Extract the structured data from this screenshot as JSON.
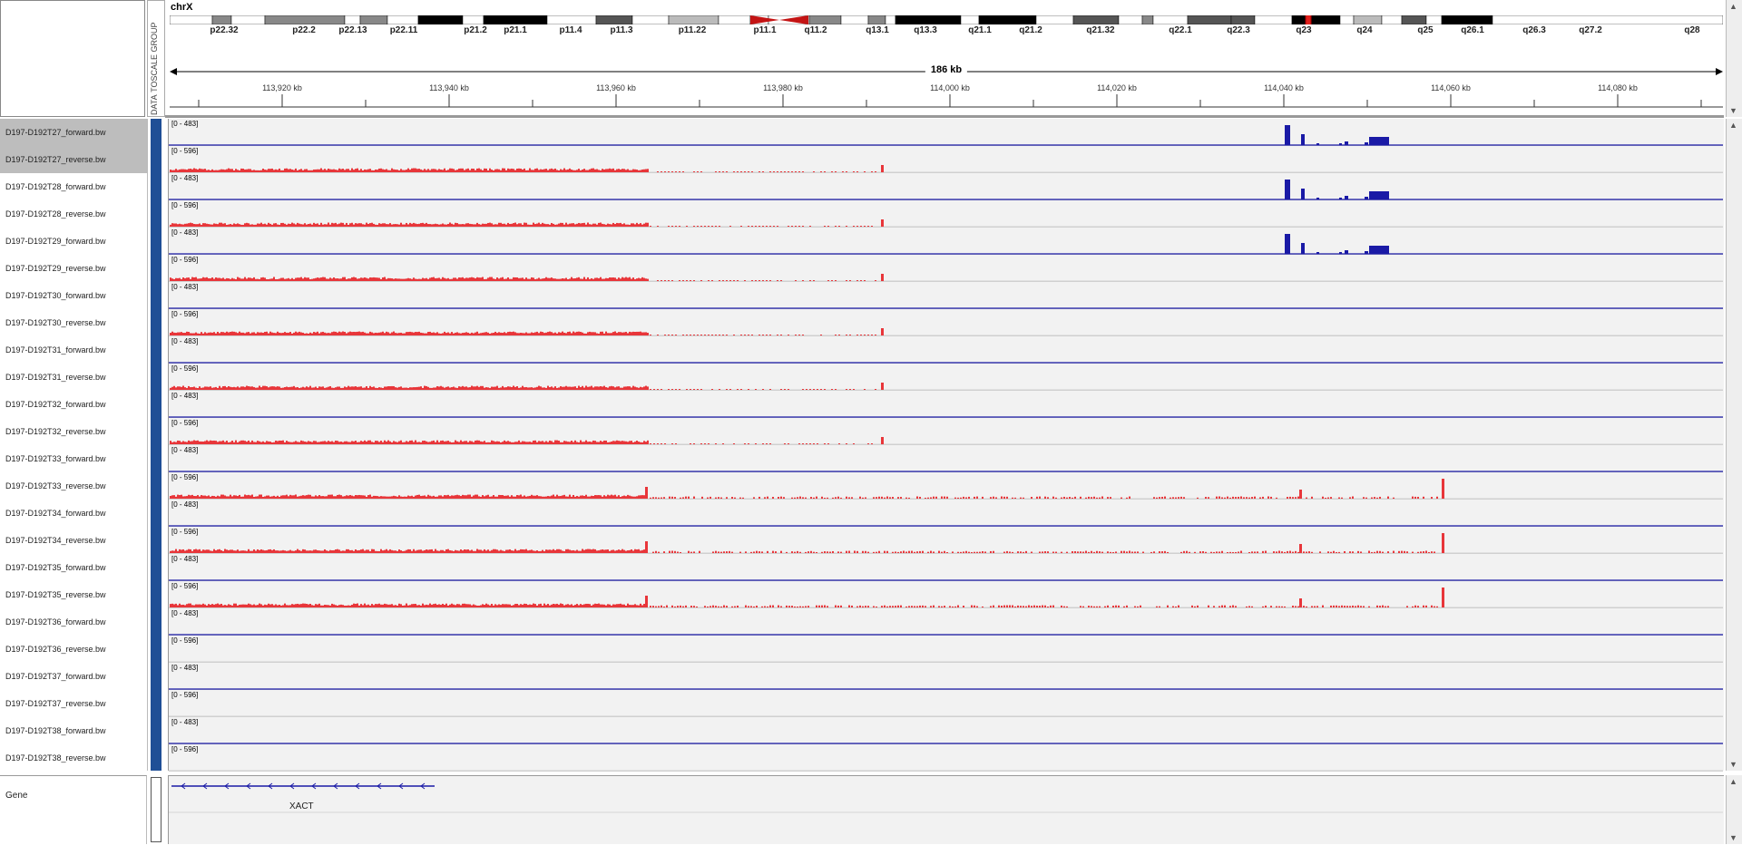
{
  "header": {
    "chromosome": "chrX",
    "span_label": "186 kb",
    "attribute_label": "DATA TOSCALE GROUP",
    "bands": [
      {
        "label": "p22.32"
      },
      {
        "label": "p22.2"
      },
      {
        "label": "p22.13"
      },
      {
        "label": "p22.11"
      },
      {
        "label": "p21.2"
      },
      {
        "label": "p21.1"
      },
      {
        "label": "p11.4"
      },
      {
        "label": "p11.3"
      },
      {
        "label": "p11.22"
      },
      {
        "label": "p11.1"
      },
      {
        "label": "q11.2"
      },
      {
        "label": "q13.1"
      },
      {
        "label": "q13.3"
      },
      {
        "label": "q21.1"
      },
      {
        "label": "q21.2"
      },
      {
        "label": "q21.32"
      },
      {
        "label": "q22.1"
      },
      {
        "label": "q22.3"
      },
      {
        "label": "q23"
      },
      {
        "label": "q24"
      },
      {
        "label": "q25"
      },
      {
        "label": "q26.1"
      },
      {
        "label": "q26.3"
      },
      {
        "label": "q27.2"
      },
      {
        "label": "q28"
      }
    ],
    "ticks": [
      "113,920 kb",
      "113,940 kb",
      "113,960 kb",
      "113,980 kb",
      "114,000 kb",
      "114,020 kb",
      "114,040 kb",
      "114,060 kb",
      "114,080 kb"
    ]
  },
  "tracks": [
    {
      "name": "D197-D192T27_forward.bw",
      "scale": "[0 - 483]",
      "strand": "forward",
      "selected": true,
      "signal": "fwd_peaks"
    },
    {
      "name": "D197-D192T27_reverse.bw",
      "scale": "[0 - 596]",
      "strand": "reverse",
      "selected": true,
      "signal": "rev_left"
    },
    {
      "name": "D197-D192T28_forward.bw",
      "scale": "[0 - 483]",
      "strand": "forward",
      "selected": false,
      "signal": "fwd_peaks"
    },
    {
      "name": "D197-D192T28_reverse.bw",
      "scale": "[0 - 596]",
      "strand": "reverse",
      "selected": false,
      "signal": "rev_left"
    },
    {
      "name": "D197-D192T29_forward.bw",
      "scale": "[0 - 483]",
      "strand": "forward",
      "selected": false,
      "signal": "fwd_peaks"
    },
    {
      "name": "D197-D192T29_reverse.bw",
      "scale": "[0 - 596]",
      "strand": "reverse",
      "selected": false,
      "signal": "rev_left"
    },
    {
      "name": "D197-D192T30_forward.bw",
      "scale": "[0 - 483]",
      "strand": "forward",
      "selected": false,
      "signal": "flat"
    },
    {
      "name": "D197-D192T30_reverse.bw",
      "scale": "[0 - 596]",
      "strand": "reverse",
      "selected": false,
      "signal": "rev_left"
    },
    {
      "name": "D197-D192T31_forward.bw",
      "scale": "[0 - 483]",
      "strand": "forward",
      "selected": false,
      "signal": "flat"
    },
    {
      "name": "D197-D192T31_reverse.bw",
      "scale": "[0 - 596]",
      "strand": "reverse",
      "selected": false,
      "signal": "rev_left"
    },
    {
      "name": "D197-D192T32_forward.bw",
      "scale": "[0 - 483]",
      "strand": "forward",
      "selected": false,
      "signal": "flat"
    },
    {
      "name": "D197-D192T32_reverse.bw",
      "scale": "[0 - 596]",
      "strand": "reverse",
      "selected": false,
      "signal": "rev_left"
    },
    {
      "name": "D197-D192T33_forward.bw",
      "scale": "[0 - 483]",
      "strand": "forward",
      "selected": false,
      "signal": "flat"
    },
    {
      "name": "D197-D192T33_reverse.bw",
      "scale": "[0 - 596]",
      "strand": "reverse",
      "selected": false,
      "signal": "rev_wide"
    },
    {
      "name": "D197-D192T34_forward.bw",
      "scale": "[0 - 483]",
      "strand": "forward",
      "selected": false,
      "signal": "flat"
    },
    {
      "name": "D197-D192T34_reverse.bw",
      "scale": "[0 - 596]",
      "strand": "reverse",
      "selected": false,
      "signal": "rev_wide"
    },
    {
      "name": "D197-D192T35_forward.bw",
      "scale": "[0 - 483]",
      "strand": "forward",
      "selected": false,
      "signal": "flat"
    },
    {
      "name": "D197-D192T35_reverse.bw",
      "scale": "[0 - 596]",
      "strand": "reverse",
      "selected": false,
      "signal": "rev_wide"
    },
    {
      "name": "D197-D192T36_forward.bw",
      "scale": "[0 - 483]",
      "strand": "forward",
      "selected": false,
      "signal": "flat"
    },
    {
      "name": "D197-D192T36_reverse.bw",
      "scale": "[0 - 596]",
      "strand": "reverse",
      "selected": false,
      "signal": "empty"
    },
    {
      "name": "D197-D192T37_forward.bw",
      "scale": "[0 - 483]",
      "strand": "forward",
      "selected": false,
      "signal": "flat"
    },
    {
      "name": "D197-D192T37_reverse.bw",
      "scale": "[0 - 596]",
      "strand": "reverse",
      "selected": false,
      "signal": "empty"
    },
    {
      "name": "D197-D192T38_forward.bw",
      "scale": "[0 - 483]",
      "strand": "forward",
      "selected": false,
      "signal": "flat"
    },
    {
      "name": "D197-D192T38_reverse.bw",
      "scale": "[0 - 596]",
      "strand": "reverse",
      "selected": false,
      "signal": "empty"
    }
  ],
  "gene_track": {
    "label": "Gene",
    "gene_symbol": "XACT"
  },
  "colors": {
    "forward": "#1a1aa6",
    "reverse": "#e8363a",
    "attribute": "#1f4f96",
    "centromere": "#c41414",
    "highlight_band": "#e0201c"
  }
}
